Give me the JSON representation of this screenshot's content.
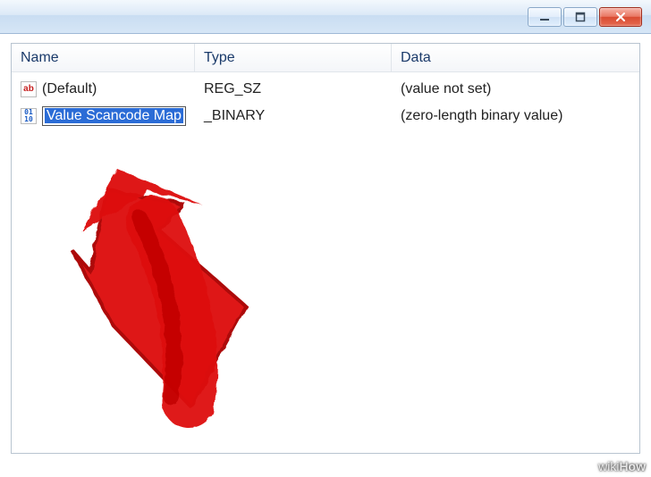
{
  "columns": {
    "name": "Name",
    "type": "Type",
    "data": "Data"
  },
  "rows": [
    {
      "icon": "ab",
      "name": "(Default)",
      "type": "REG_SZ",
      "data": "(value not set)",
      "editing": false
    },
    {
      "icon": "bin",
      "name": "Value Scancode Map",
      "type_suffix": "_BINARY",
      "data": "(zero-length binary value)",
      "editing": true
    }
  ],
  "icons": {
    "ab_label": "ab",
    "bin_label": "011\n110"
  },
  "watermark": {
    "wiki": "wiki",
    "how": "How"
  }
}
